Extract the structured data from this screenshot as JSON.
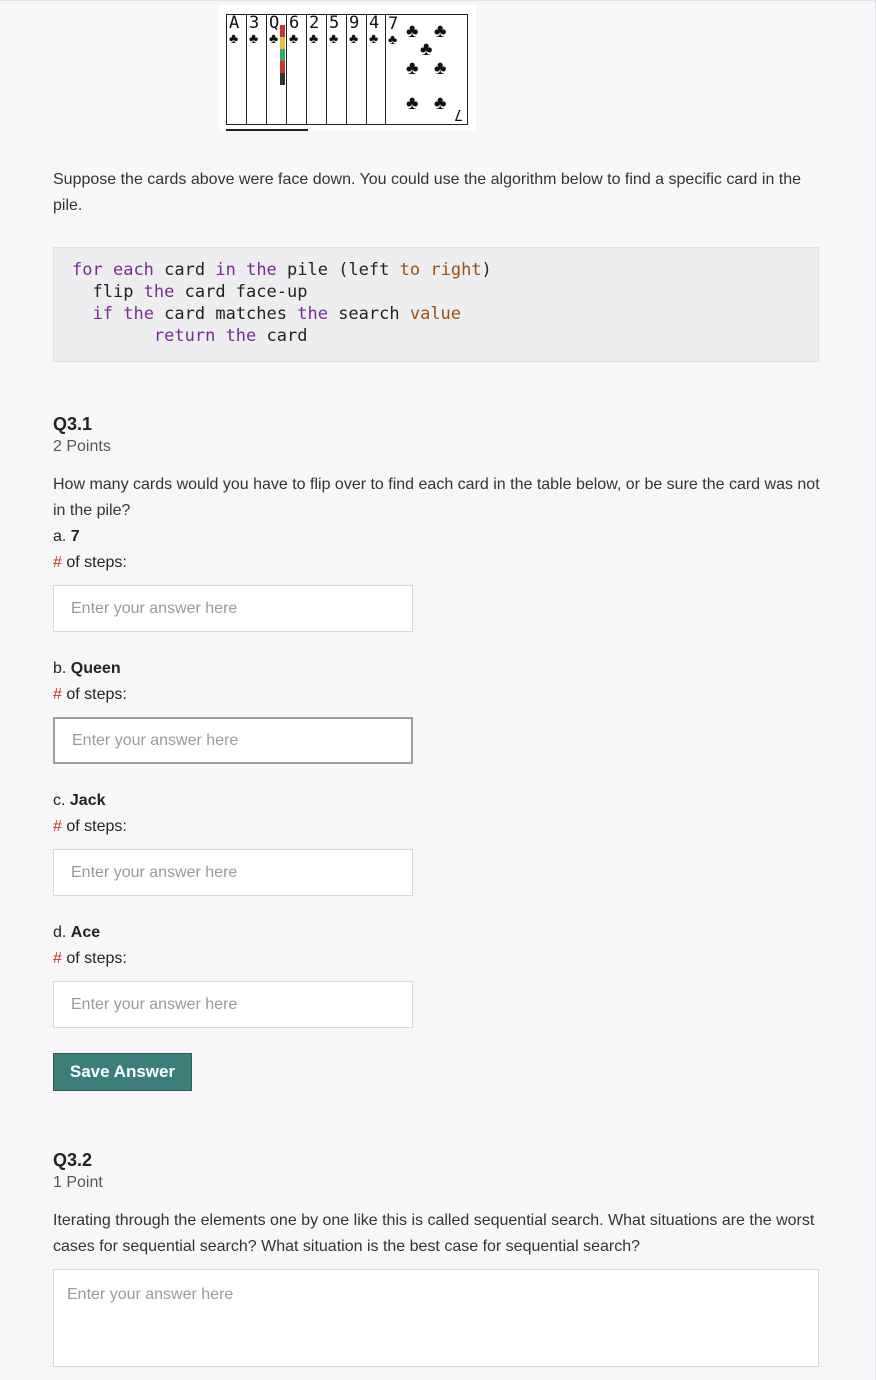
{
  "cards": {
    "ranks": [
      "A",
      "3",
      "Q",
      "6",
      "2",
      "5",
      "9",
      "4"
    ],
    "last_rank": "7",
    "suit_glyph": "♣"
  },
  "intro": "Suppose the cards above were face down. You could use the algorithm below to find a specific card in the pile.",
  "code": {
    "line1": {
      "for": "for",
      "each": "each",
      "card": " card ",
      "in": "in",
      "sp": " ",
      "the": "the",
      "pile": " pile (left ",
      "to": "to",
      "sp2": " ",
      "right": "right",
      ")": ")"
    },
    "line2": {
      "flip": "flip ",
      "the": "the",
      "rest": " card face-up"
    },
    "line3": {
      "if": "if",
      "sp": " ",
      "the": "the",
      "mid": " card matches ",
      "the2": "the",
      "mid2": " search ",
      "value": "value"
    },
    "line4": {
      "return": "return",
      "sp": " ",
      "the": "the",
      "rest": " card"
    }
  },
  "q31": {
    "title": "Q3.1",
    "points": "2 Points",
    "prompt": "How many cards would you have to flip over to find each card in the table below, or be sure the card was not in the pile?",
    "steps_hash": "#",
    "steps_label": " of steps:",
    "items": [
      {
        "prefix": "a. ",
        "name": "7",
        "placeholder": "Enter your answer here"
      },
      {
        "prefix": "b. ",
        "name": "Queen",
        "placeholder": "Enter your answer here"
      },
      {
        "prefix": "c. ",
        "name": "Jack",
        "placeholder": "Enter your answer here"
      },
      {
        "prefix": "d. ",
        "name": "Ace",
        "placeholder": "Enter your answer here"
      }
    ],
    "save_label": "Save Answer"
  },
  "q32": {
    "title": "Q3.2",
    "points": "1 Point",
    "prompt": "Iterating through the elements one by one like this is called sequential search. What situations are the worst cases for sequential search? What situation is the best case for sequential search?",
    "placeholder": "Enter your answer here"
  }
}
